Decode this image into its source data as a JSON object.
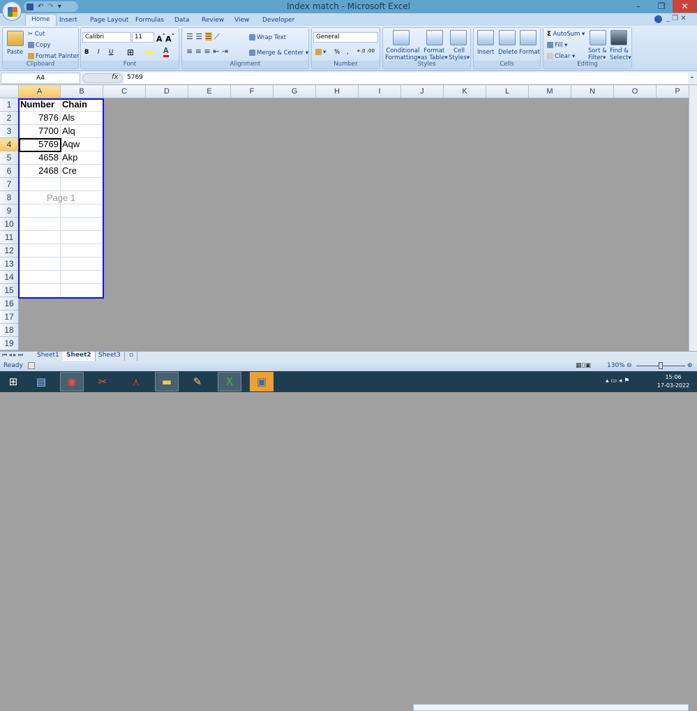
{
  "window": {
    "title": "Index match - Microsoft Excel"
  },
  "qat": {
    "save": "save-icon",
    "undo": "↶",
    "redo": "↷"
  },
  "tabs": [
    "Home",
    "Insert",
    "Page Layout",
    "Formulas",
    "Data",
    "Review",
    "View",
    "Developer"
  ],
  "ribbon": {
    "clipboard": {
      "label": "Clipboard",
      "paste": "Paste",
      "cut": "Cut",
      "copy": "Copy",
      "format_painter": "Format Painter"
    },
    "font": {
      "label": "Font",
      "font_name": "Calibri",
      "font_size": "11",
      "bold": "B",
      "italic": "I",
      "underline": "U"
    },
    "alignment": {
      "label": "Alignment",
      "wrap_text": "Wrap Text",
      "merge_center": "Merge & Center"
    },
    "number": {
      "label": "Number",
      "format": "General",
      "percent": "%",
      "comma": ","
    },
    "styles": {
      "label": "Styles",
      "conditional": [
        "Conditional",
        "Formatting"
      ],
      "format_table": [
        "Format",
        "as Table"
      ],
      "cell_styles": [
        "Cell",
        "Styles"
      ]
    },
    "cells": {
      "label": "Cells",
      "insert": "Insert",
      "delete": "Delete",
      "format": "Format"
    },
    "editing": {
      "label": "Editing",
      "autosum": "AutoSum",
      "fill": "Fill",
      "clear": "Clear",
      "sort": [
        "Sort &",
        "Filter"
      ],
      "find": [
        "Find &",
        "Select"
      ]
    }
  },
  "formula_bar": {
    "name_box": "A4",
    "fx": "fx",
    "value": "5769"
  },
  "sheet": {
    "columns": [
      "A",
      "B",
      "C",
      "D",
      "E",
      "F",
      "G",
      "H",
      "I",
      "J",
      "K",
      "L",
      "M",
      "N",
      "O",
      "P"
    ],
    "rows": 19,
    "selected_cell": "A4",
    "page_label": "Page 1",
    "cells": [
      [
        {
          "v": "Number",
          "bold": true
        },
        {
          "v": "Chain",
          "bold": true
        }
      ],
      [
        {
          "v": "7876",
          "num": true
        },
        {
          "v": "Als"
        }
      ],
      [
        {
          "v": "7700",
          "num": true
        },
        {
          "v": "Alq"
        }
      ],
      [
        {
          "v": "5769",
          "num": true
        },
        {
          "v": "Aqw"
        }
      ],
      [
        {
          "v": "4658",
          "num": true
        },
        {
          "v": "Akp"
        }
      ],
      [
        {
          "v": "2468",
          "num": true
        },
        {
          "v": "Cre"
        }
      ]
    ]
  },
  "sheet_tabs": [
    "Sheet1",
    "Sheet2",
    "Sheet3"
  ],
  "active_sheet": "Sheet2",
  "status": {
    "mode": "Ready",
    "zoom": "130%"
  },
  "taskbar": {
    "time": "15:06",
    "date": "17-03-2022"
  }
}
